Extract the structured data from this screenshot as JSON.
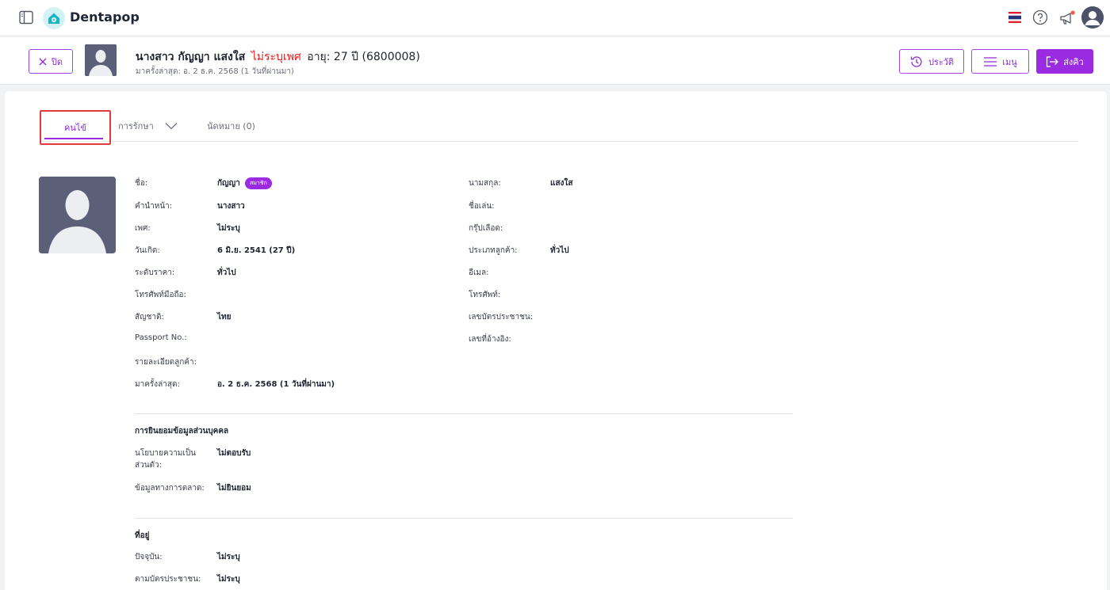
{
  "app": {
    "brand": "Dentapop"
  },
  "header": {
    "close_label": "ปิด",
    "title_name": "นางสาว กัญญา แสงใส",
    "title_gender": "ไม่ระบุเพศ",
    "title_age": "อายุ: 27 ปี",
    "title_hn": "(6800008)",
    "last_visit": "มาครั้งล่าสุด: อ. 2 ธ.ค. 2568 (1 วันที่ผ่านมา)",
    "history_label": "ประวัติ",
    "menu_label": "เมนู",
    "send_label": "ส่งคิว"
  },
  "tabs": {
    "patient": "คนไข้",
    "treatment": "การรักษา",
    "appointment": "นัดหมาย (0)"
  },
  "profile": {
    "member_badge": "สมาชิก",
    "left": [
      {
        "label": "ชื่อ:",
        "value": "กัญญา"
      },
      {
        "label": "คำนำหน้า:",
        "value": "นางสาว"
      },
      {
        "label": "เพศ:",
        "value": "ไม่ระบุ"
      },
      {
        "label": "วันเกิด:",
        "value": "6 มิ.ย. 2541 (27 ปี)"
      },
      {
        "label": "ระดับราคา:",
        "value": "ทั่วไป"
      },
      {
        "label": "โทรศัพท์มือถือ:",
        "value": ""
      },
      {
        "label": "สัญชาติ:",
        "value": "ไทย"
      },
      {
        "label": "Passport No.:",
        "value": ""
      },
      {
        "label": "รายละเอียดลูกค้า:",
        "value": ""
      },
      {
        "label": "มาครั้งล่าสุด:",
        "value": "อ. 2 ธ.ค. 2568 (1 วันที่ผ่านมา)"
      }
    ],
    "right": [
      {
        "label": "นามสกุล:",
        "value": "แสงใส"
      },
      {
        "label": "ชื่อเล่น:",
        "value": ""
      },
      {
        "label": "กรุ๊ปเลือด:",
        "value": ""
      },
      {
        "label": "ประเภทลูกค้า:",
        "value": "ทั่วไป"
      },
      {
        "label": "อีเมล:",
        "value": ""
      },
      {
        "label": "โทรศัพท์:",
        "value": ""
      },
      {
        "label": "เลขบัตรประชาชน:",
        "value": ""
      },
      {
        "label": "เลขที่อ้างอิง:",
        "value": ""
      }
    ]
  },
  "consent": {
    "title": "การยินยอมข้อมูลส่วนบุคคล",
    "privacy_label_1": "นโยบายความเป็น",
    "privacy_label_2": "ส่วนตัว:",
    "privacy_value": "ไม่ตอบรับ",
    "marketing_label": "ข้อมูลทางการตลาด:",
    "marketing_value": "ไม่ยินยอม"
  },
  "address": {
    "title": "ที่อยู่",
    "current_label": "ปัจจุบัน:",
    "current_value": "ไม่ระบุ",
    "idcard_label": "ตามบัตรประชาชน:",
    "idcard_value": "ไม่ระบุ"
  }
}
